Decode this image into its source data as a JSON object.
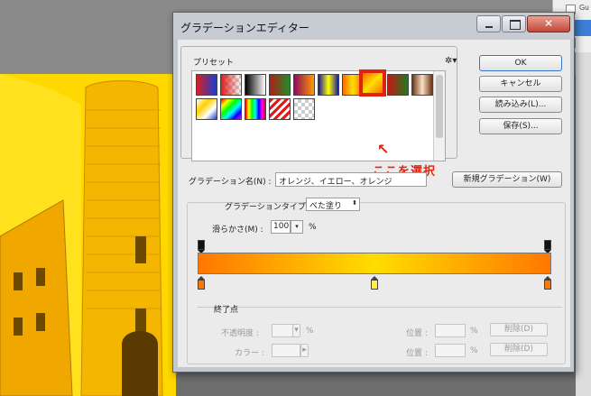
{
  "dialog": {
    "title": "グラデーションエディター",
    "close_label": "✕"
  },
  "background_panel": {
    "layer_label": "Gu"
  },
  "presets": {
    "label": "プリセット",
    "gear_icon": "gear-icon",
    "annotation": "ここを選択",
    "annotation_arrow": "↖",
    "swatches_row1": [
      "linear-gradient(90deg,#d81e24,#1a3fd0)",
      "checker-red",
      "linear-gradient(90deg,#000,#fff)",
      "linear-gradient(90deg,#b21c16,#1f8f2a)",
      "linear-gradient(90deg,#8b0a5a,#ff9a00)",
      "linear-gradient(90deg,#1a1aa0,#ffff00,#1a1aa0)",
      "selected-orange-yellow",
      "linear-gradient(90deg,#c41a14,#1f7a1f)",
      "linear-gradient(90deg,#0a2a9a,#ffd800,#0a2a9a)",
      "linear-gradient(90deg,#6b3515,#fbe0c8,#6b3515)"
    ],
    "swatches_row2": [
      "linear-gradient(135deg,#fff,#ffd000,#fff,#1a3fd0)",
      "linear-gradient(90deg,#e00,#ff0,#0f0,#0ff,#00f,#f0f,#e00)",
      "linear-gradient(135deg,#ff0000,#ff0,#0f0,#0ff,#00f)",
      "stripes-red",
      "checker-gray"
    ]
  },
  "buttons": {
    "ok": "OK",
    "cancel": "キャンセル",
    "load": "読み込み(L)...",
    "save": "保存(S)..."
  },
  "name": {
    "label": "グラデーション名(N) :",
    "value": "オレンジ、イエロー、オレンジ",
    "new_button": "新規グラデーション(W)"
  },
  "type": {
    "label": "グラデーションタイプ :",
    "value": "べた塗り",
    "dropdown_icon": "chevron-down-icon"
  },
  "smoothness": {
    "label": "滑らかさ(M) :",
    "value": "100",
    "unit": "%"
  },
  "gradient_bar": {
    "colors": [
      "#ff7700",
      "#ffdd00",
      "#ff7700"
    ],
    "opacity_stops": [
      0,
      100
    ],
    "color_stops": [
      {
        "position": 0,
        "color": "#ff7700"
      },
      {
        "position": 50,
        "color": "#ffee44"
      },
      {
        "position": 100,
        "color": "#ff7700"
      }
    ]
  },
  "stops": {
    "title": "終了点",
    "opacity_label": "不透明度 :",
    "opacity_unit": "%",
    "color_label": "カラー :",
    "location_label": "位置 :",
    "location_unit": "%",
    "delete_label": "削除(D)"
  }
}
